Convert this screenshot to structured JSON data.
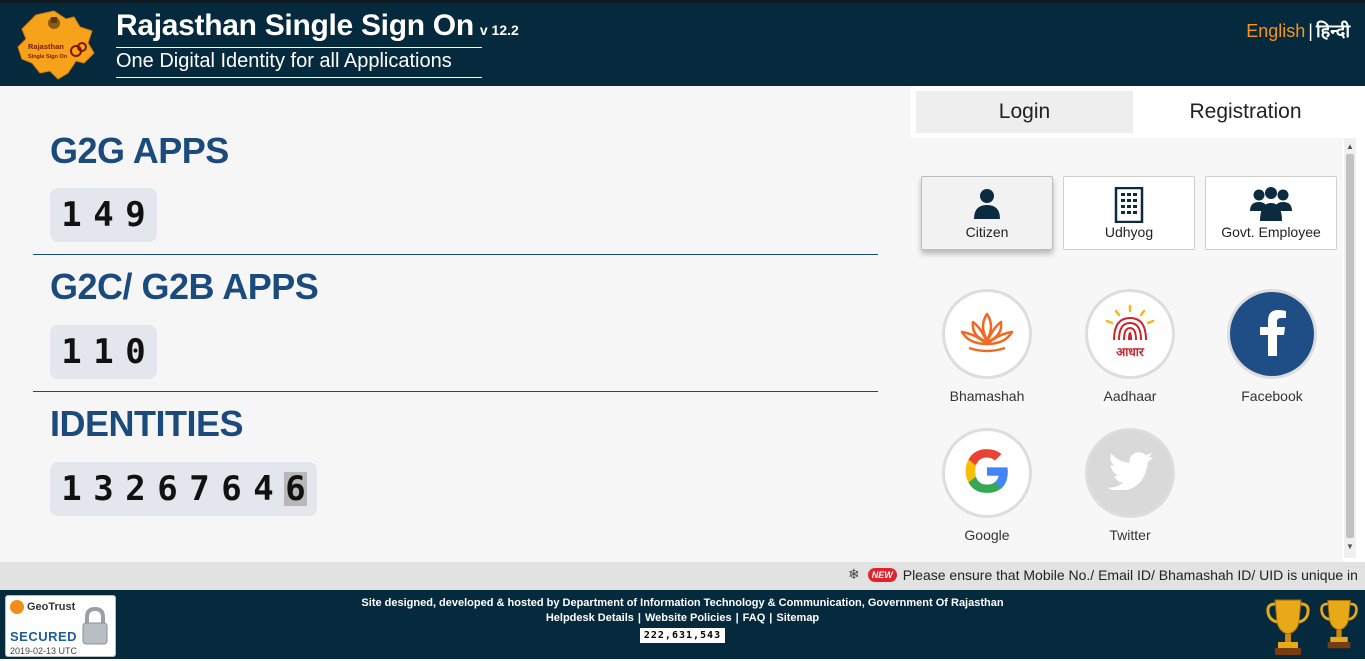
{
  "header": {
    "title": "Rajasthan Single Sign On",
    "version": "v 12.2",
    "tagline": "One Digital Identity for all Applications",
    "logo_text_1": "Rajasthan",
    "logo_text_2": "Single Sign On",
    "lang_english": "English",
    "lang_separator": "|",
    "lang_hindi": "हिन्दी"
  },
  "stats": [
    {
      "title": "G2G APPS",
      "digits": [
        "1",
        "4",
        "9"
      ]
    },
    {
      "title": "G2C/ G2B APPS",
      "digits": [
        "1",
        "1",
        "0"
      ]
    },
    {
      "title": "IDENTITIES",
      "digits": [
        "1",
        "3",
        "2",
        "6",
        "7",
        "6",
        "4",
        "6"
      ]
    }
  ],
  "tabs": {
    "login": "Login",
    "registration": "Registration"
  },
  "user_types": [
    {
      "label": "Citizen",
      "icon": "user-icon",
      "active": true
    },
    {
      "label": "Udhyog",
      "icon": "building-icon",
      "active": false
    },
    {
      "label": "Govt. Employee",
      "icon": "group-icon",
      "active": false
    }
  ],
  "social": [
    {
      "label": "Bhamashah",
      "icon": "lotus-icon"
    },
    {
      "label": "Aadhaar",
      "icon": "aadhaar-icon",
      "icon_text": "आधार"
    },
    {
      "label": "Facebook",
      "icon": "facebook-icon"
    },
    {
      "label": "Google",
      "icon": "google-icon"
    },
    {
      "label": "Twitter",
      "icon": "twitter-icon"
    }
  ],
  "ticker": {
    "badge": "NEW",
    "text": "Please ensure that Mobile No./ Email ID/ Bhamashah ID/ UID is unique in"
  },
  "footer": {
    "credit": "Site designed, developed & hosted by Department of Information Technology & Communication, Government Of Rajasthan",
    "links": [
      "Helpdesk Details",
      "Website Policies",
      "FAQ",
      "Sitemap"
    ],
    "visitor_count": "222,631,543",
    "geotrust_brand": "GeoTrust",
    "geotrust_secured": "SECURED",
    "geotrust_date": "2019-02-13 UTC"
  },
  "colors": {
    "header_bg": "#062a3d",
    "stat_title": "#1a4b7c",
    "lang_accent": "#f7941d",
    "facebook": "#1f4e86"
  }
}
